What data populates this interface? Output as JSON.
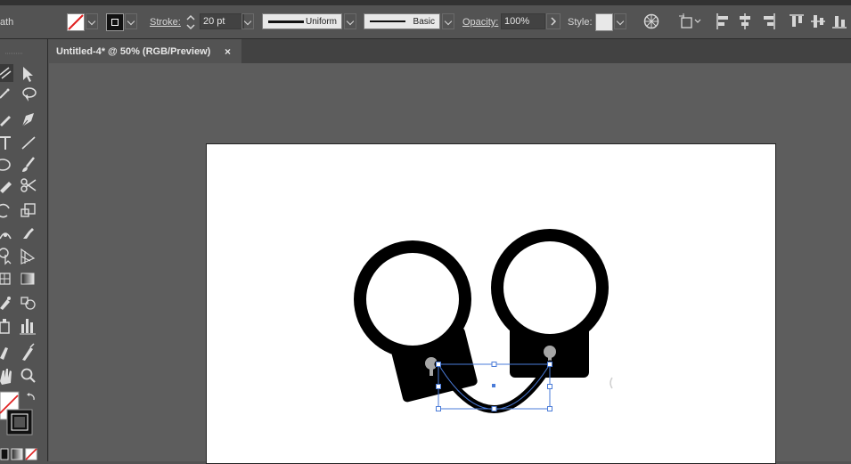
{
  "control_bar": {
    "path_label": "ath",
    "fill_label": "fill-none",
    "stroke_label": "Stroke:",
    "stroke_value": "20 pt",
    "variable_width_profile": "Uniform",
    "brush_definition": "Basic",
    "opacity_label": "Opacity:",
    "opacity_value": "100%",
    "style_label": "Style:"
  },
  "document_tab": {
    "title": "Untitled-4* @ 50% (RGB/Preview)",
    "close": "×"
  },
  "colors": {
    "ui_background": "#535353",
    "canvas": "#5d5d5d",
    "artboard": "#ffffff",
    "selection": "#4a7bd8",
    "handcuff": "#000000",
    "pin": "#a6a6a6"
  },
  "icons": {
    "tools": [
      "artboard-tool-icon",
      "direct-selection-icon",
      "magic-wand-icon",
      "lasso-icon",
      "pencil-icon",
      "pen-icon",
      "type-icon",
      "line-segment-icon",
      "ellipse-icon",
      "paintbrush-icon",
      "eraser-icon",
      "scissors-icon",
      "rotate-icon",
      "scale-icon",
      "width-tool-icon",
      "puppet-warp-icon",
      "shape-builder-icon",
      "perspective-grid-icon",
      "mesh-icon",
      "gradient-icon",
      "eyedropper-icon",
      "blend-icon",
      "symbol-sprayer-icon",
      "column-graph-icon",
      "slice-icon",
      "hand-icon",
      "zoom-icon"
    ]
  }
}
